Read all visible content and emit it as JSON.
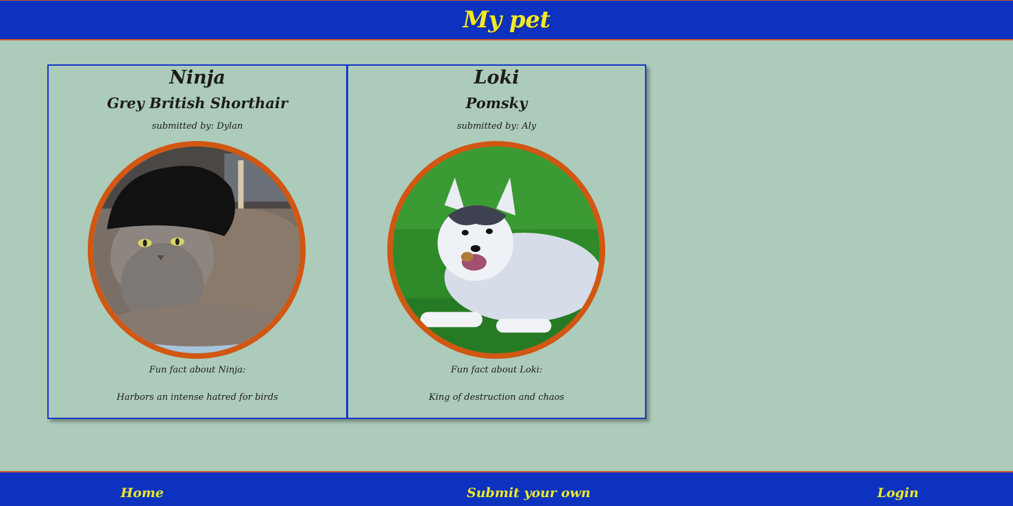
{
  "header": {
    "title": "My pet"
  },
  "pets": [
    {
      "name": "Ninja",
      "breed": "Grey British Shorthair",
      "submitted_by": "submitted by: Dylan",
      "fact_label": "Fun fact about Ninja:",
      "fact_text": "Harbors an intense hatred for birds"
    },
    {
      "name": "Loki",
      "breed": "Pomsky",
      "submitted_by": "submitted by: Aly",
      "fact_label": "Fun fact about Loki:",
      "fact_text": "King of destruction and chaos"
    }
  ],
  "footer": {
    "home": "Home",
    "submit": "Submit your own",
    "login": "Login"
  },
  "colors": {
    "background": "#adcbba",
    "bar": "#0c32bf",
    "accent_text": "#eeea28",
    "photo_ring": "#d15712",
    "card_border": "#1638c9"
  }
}
